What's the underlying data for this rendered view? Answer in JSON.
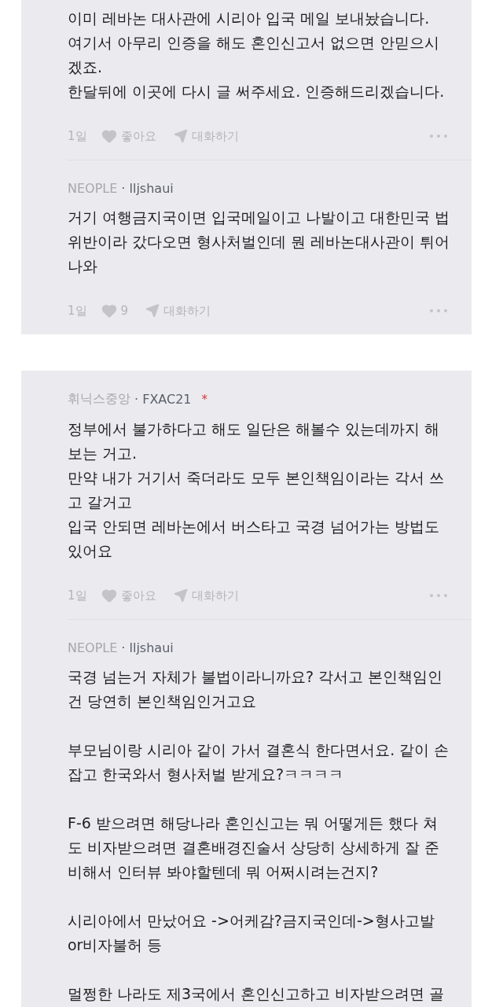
{
  "threads": [
    {
      "comments": [
        {
          "paragraphs": [
            [
              "이미 레바논 대사관에 시리아 입국 메일 보내놨습니다.",
              "여기서 아무리 인증을 해도 혼인신고서 없으면 안믿으시",
              "겠죠.",
              "한달뒤에 이곳에 다시 글 써주세요. 인증해드리겠습니다."
            ]
          ],
          "time": "1일",
          "likes": "좋아요",
          "reply": "대화하기"
        },
        {
          "org": "NEOPLE",
          "user": "· lljshaui",
          "paragraphs": [
            [
              "거기 여행금지국이면 입국메일이고 나발이고 대한민국 법",
              "위반이라 갔다오면 형사처벌인데 뭔 레바논대사관이 튀어",
              "나와"
            ]
          ],
          "time": "1일",
          "likes": "9",
          "reply": "대화하기"
        }
      ]
    },
    {
      "comments": [
        {
          "org": "휘닉스중앙",
          "user": "· FXAC21",
          "flag": "*",
          "paragraphs": [
            [
              "정부에서 불가하다고 해도 일단은 해볼수 있는데까지 해",
              "보는 거고.",
              "만약 내가 거기서 죽더라도 모두 본인책임이라는 각서 쓰",
              "고 갈거고",
              "입국 안되면 레바논에서 버스타고 국경 넘어가는 방법도",
              "있어요"
            ]
          ],
          "time": "1일",
          "likes": "좋아요",
          "reply": "대화하기"
        },
        {
          "org": "NEOPLE",
          "user": "· lljshaui",
          "paragraphs": [
            [
              "국경 넘는거 자체가 불법이라니까요? 각서고 본인책임인",
              "건 당연히 본인책임인거고요"
            ],
            [
              "부모님이랑 시리아 같이 가서 결혼식 한다면서요. 같이 손",
              "잡고 한국와서 형사처벌 받게요?ㅋㅋㅋㅋ"
            ],
            [
              "F-6 받으려면 해당나라 혼인신고는 뭐 어떻게든 했다 쳐",
              "도 비자받으려면 결혼배경진술서 상당히 상세하게 잘 준",
              "비해서 인터뷰 봐야할텐데 뭐 어쩌시려는건지?"
            ],
            [
              "시리아에서 만났어요 ->어케감?금지국인데->형사고발",
              "or비자불허 등"
            ],
            [
              "멀쩡한 나라도 제3국에서 혼인신고하고 비자받으려면 골"
            ]
          ]
        }
      ]
    }
  ]
}
